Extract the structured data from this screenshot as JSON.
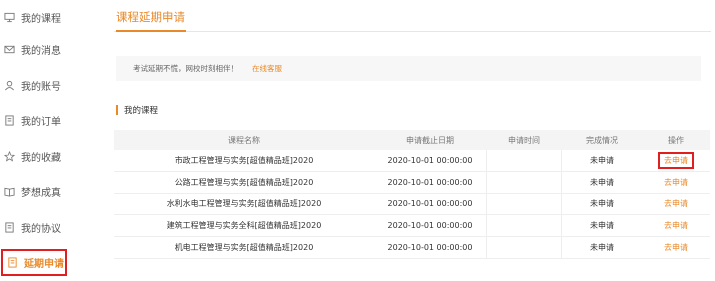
{
  "sidebar": {
    "items": [
      {
        "label": "我的课程",
        "icon": "monitor-icon",
        "active": false
      },
      {
        "label": "我的消息",
        "icon": "mail-icon",
        "active": false
      },
      {
        "label": "我的账号",
        "icon": "user-icon",
        "active": false
      },
      {
        "label": "我的订单",
        "icon": "document-icon",
        "active": false
      },
      {
        "label": "我的收藏",
        "icon": "star-icon",
        "active": false
      },
      {
        "label": "梦想成真",
        "icon": "book-icon",
        "active": false
      },
      {
        "label": "我的协议",
        "icon": "document-icon",
        "active": false
      },
      {
        "label": "延期申请",
        "icon": "document-icon",
        "active": true
      }
    ]
  },
  "main": {
    "tab": "课程延期申请",
    "notice": {
      "text": "考试延期不慌，网校时刻相伴！",
      "link": "在线客服"
    },
    "section_title": "我的课程",
    "table": {
      "headers": [
        "课程名称",
        "申请截止日期",
        "申请时间",
        "完成情况",
        "操作"
      ],
      "rows": [
        {
          "name": "市政工程管理与实务[超值精品班]2020",
          "deadline": "2020-10-01 00:00:00",
          "applied": "",
          "status": "未申请",
          "action": "去申请"
        },
        {
          "name": "公路工程管理与实务[超值精品班]2020",
          "deadline": "2020-10-01 00:00:00",
          "applied": "",
          "status": "未申请",
          "action": "去申请"
        },
        {
          "name": "水利水电工程管理与实务[超值精品班]2020",
          "deadline": "2020-10-01 00:00:00",
          "applied": "",
          "status": "未申请",
          "action": "去申请"
        },
        {
          "name": "建筑工程管理与实务全科[超值精品班]2020",
          "deadline": "2020-10-01 00:00:00",
          "applied": "",
          "status": "未申请",
          "action": "去申请"
        },
        {
          "name": "机电工程管理与实务[超值精品班]2020",
          "deadline": "2020-10-01 00:00:00",
          "applied": "",
          "status": "未申请",
          "action": "去申请"
        }
      ]
    }
  },
  "colors": {
    "accent": "#e88a2a",
    "highlight": "#e02020"
  }
}
